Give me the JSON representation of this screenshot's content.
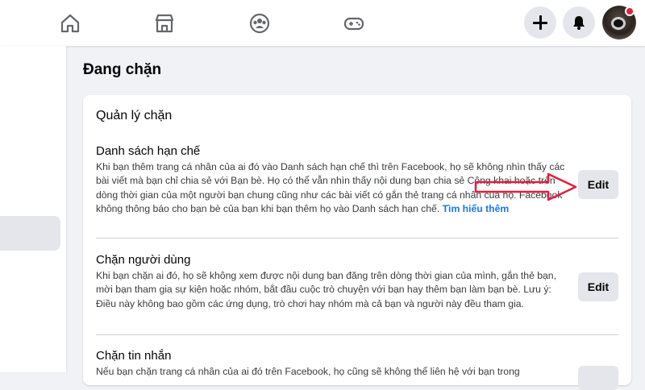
{
  "topbar": {
    "icons": [
      "home-icon",
      "marketplace-icon",
      "groups-icon",
      "gaming-icon"
    ],
    "actions": [
      "plus-icon",
      "bell-icon",
      "avatar"
    ]
  },
  "page": {
    "title": "Đang chặn"
  },
  "card": {
    "title": "Quản lý chặn",
    "sections": [
      {
        "heading": "Danh sách hạn chế",
        "body": "Khi bạn thêm trang cá nhân của ai đó vào Danh sách hạn chế thì trên Facebook, họ sẽ không nhìn thấy các bài viết mà bạn chỉ chia sẻ với Bạn bè. Họ có thể vẫn nhìn thấy nội dung bạn chia sẻ Công khai hoặc trên dòng thời gian của một người bạn chung cũng như các bài viết có gắn thẻ trang cá nhân của họ. Facebook không thông báo cho bạn bè của bạn khi bạn thêm họ vào Danh sách hạn chế.",
        "link": "Tìm hiểu thêm",
        "button": "Edit"
      },
      {
        "heading": "Chặn người dùng",
        "body": "Khi bạn chặn ai đó, họ sẽ không xem được nội dung bạn đăng trên dòng thời gian của mình, gắn thẻ bạn, mời bạn tham gia sự kiện hoặc nhóm, bắt đầu cuộc trò chuyện với bạn hay thêm bạn làm bạn bè. Lưu ý: Điều này không bao gồm các ứng dụng, trò chơi hay nhóm mà cả bạn và người này đều tham gia.",
        "button": "Edit"
      },
      {
        "heading": "Chặn tin nhắn",
        "body": "Nếu bạn chặn trang cá nhân của ai đó trên Facebook, họ cũng sẽ không thể liên hệ với bạn trong"
      }
    ]
  },
  "colors": {
    "link": "#1877f2",
    "arrow": "#e41e3f",
    "button_bg": "#e4e6eb"
  }
}
